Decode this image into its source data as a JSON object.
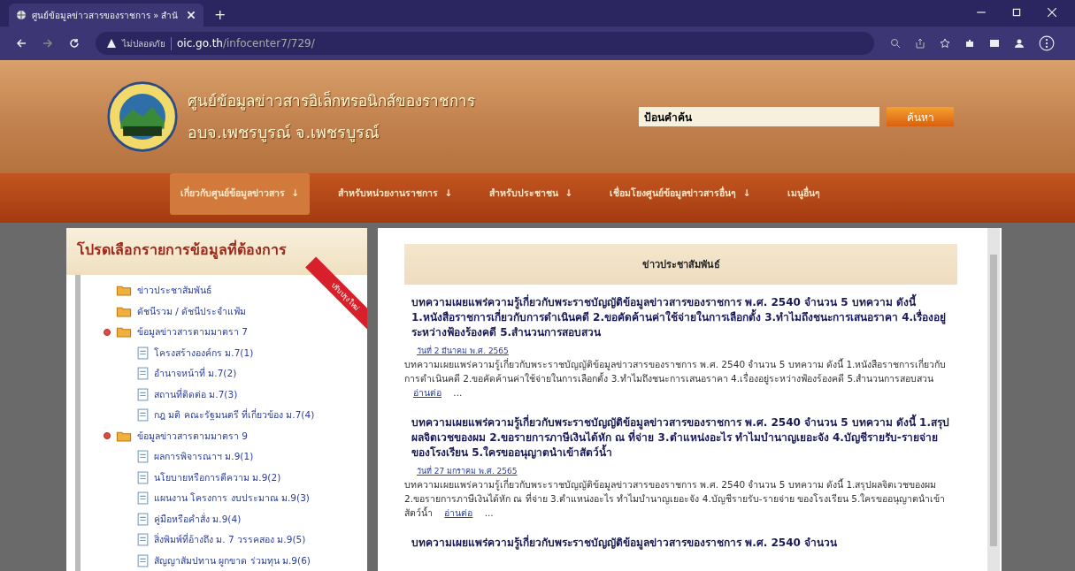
{
  "browser": {
    "tab_title": "ศูนย์ข้อมูลข่าวสารของราชการ » สำนั",
    "new_tab": "+",
    "security": "ไม่ปลอดภัย",
    "url_host": "oic.go.th",
    "url_path": "/infocenter7/729/"
  },
  "header": {
    "site_title": "ศูนย์ข้อมูลข่าวสารอิเล็กทรอนิกส์ของราชการ",
    "site_subtitle": "อบจ.เพชรบูรณ์ จ.เพชรบูรณ์",
    "search_value": "ป้อนคำค้น",
    "search_button": "ค้นหา"
  },
  "nav": [
    {
      "label": "เกี่ยวกับศูนย์ข้อมูลข่าวสาร",
      "arrow": "↓",
      "selected": true
    },
    {
      "label": "สำหรับหน่วยงานราชการ",
      "arrow": "↓",
      "selected": false
    },
    {
      "label": "สำหรับประชาชน",
      "arrow": "↓",
      "selected": false
    },
    {
      "label": "เชื่อมโยงศูนย์ข้อมูลข่าวสารอื่นๆ",
      "arrow": "↓",
      "selected": false
    },
    {
      "label": "เมนูอื่นๆ",
      "selected": false
    }
  ],
  "sidebar": {
    "title": "โปรดเลือกรายการข้อมูลที่ต้องการ",
    "ribbon": "ปรับปรุงใหม่",
    "items": [
      {
        "label": "ข่าวประชาสัมพันธ์"
      },
      {
        "label": "ดัชนีรวม / ดัชนีประจำแฟ้ม"
      },
      {
        "label": "ข้อมูลข่าวสารตามมาตรา 7",
        "children": [
          {
            "label": "โครงสร้างองค์กร ม.7(1)"
          },
          {
            "label": "อำนาจหน้าที่ ม.7(2)"
          },
          {
            "label": "สถานที่ติดต่อ ม.7(3)"
          },
          {
            "label": "กฎ มติ คณะรัฐมนตรี ที่เกี่ยวข้อง ม.7(4)"
          }
        ]
      },
      {
        "label": "ข้อมูลข่าวสารตามมาตรา 9",
        "children": [
          {
            "label": "ผลการพิจารณาฯ ม.9(1)"
          },
          {
            "label": "นโยบายหรือการตีความ ม.9(2)"
          },
          {
            "label": "แผนงาน โครงการ งบประมาณ ม.9(3)"
          },
          {
            "label": "คู่มือหรือคำสั่ง ม.9(4)"
          },
          {
            "label": "สิ่งพิมพ์ที่อ้างถึง ม. 7 วรรคสอง ม.9(5)"
          },
          {
            "label": "สัญญาสัมปทาน ผูกขาด ร่วมทุน ม.9(6)"
          }
        ]
      }
    ]
  },
  "main": {
    "heading": "ข่าวประชาสัมพันธ์",
    "articles": [
      {
        "title": "บทความเผยแพร่ความรู้เกี่ยวกับพระราชบัญญัติข้อมูลข่าวสารของราชการ พ.ศ. 2540 จำนวน 5 บทความ ดังนี้ 1.หนังสือราชการเกี่ยวกับการดำเนินคดี 2.ขอคัดค้านค่าใช้จ่ายในการเลือกตั้ง 3.ทำไมถึงชนะการเสนอราคา 4.เรื่องอยู่ระหว่างฟ้องร้องคดี 5.สำนวนการสอบสวน",
        "date": "วันที่ 2 มีนาคม พ.ศ. 2565",
        "summary": "บทความเผยแพร่ความรู้เกี่ยวกับพระราชบัญญัติข้อมูลข่าวสารของราชการ พ.ศ. 2540 จำนวน 5 บทความ ดังนี้ 1.หนังสือราชการเกี่ยวกับการดำเนินคดี 2.ขอคัดค้านค่าใช้จ่ายในการเลือกตั้ง 3.ทำไมถึงชนะการเสนอราคา 4.เรื่องอยู่ระหว่างฟ้องร้องคดี 5.สำนวนการสอบสวน",
        "more": "อ่านต่อ",
        "ellipsis": "..."
      },
      {
        "title": "บทความเผยแพร่ความรู้เกี่ยวกับพระราชบัญญัติข้อมูลข่าวสารของราชการ พ.ศ. 2540 จำนวน 5 บทความ ดังนี้ 1.สรุปผลจิตเวชของผม 2.ขอรายการภาษีเงินได้หัก ณ ที่จ่าย 3.ตำแหน่งอะไร ทำไมบำนาญเยอะจัง 4.บัญชีรายรับ-รายจ่าย ของโรงเรียน 5.ใครขออนุญาตนำเข้าสัตว์น้ำ",
        "date": "วันที่ 27 มกราคม พ.ศ. 2565",
        "summary": "บทความเผยแพร่ความรู้เกี่ยวกับพระราชบัญญัติข้อมูลข่าวสารของราชการ พ.ศ. 2540 จำนวน 5 บทความ ดังนี้ 1.สรุปผลจิตเวชของผม 2.ขอรายการภาษีเงินได้หัก ณ ที่จ่าย 3.ตำแหน่งอะไร ทำไมบำนาญเยอะจัง 4.บัญชีรายรับ-รายจ่าย ของโรงเรียน 5.ใครขออนุญาตนำเข้าสัตว์น้ำ",
        "more": "อ่านต่อ",
        "ellipsis": "..."
      },
      {
        "title": "บทความเผยแพร่ความรู้เกี่ยวกับพระราชบัญญัติข้อมูลข่าวสารของราชการ พ.ศ. 2540 จำนวน"
      }
    ]
  }
}
